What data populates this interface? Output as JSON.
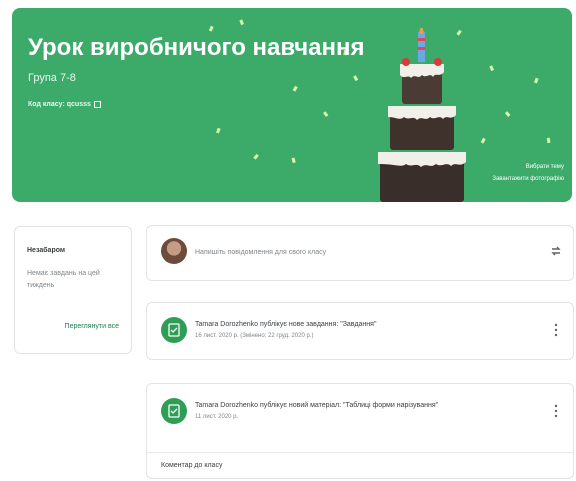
{
  "banner": {
    "title": "Урок виробничого навчання",
    "subtitle": "Група 7-8",
    "class_code": "Код класу: qcusss",
    "link_select": "Вибрати тему",
    "link_upload": "Завантажити фотографію",
    "color": "#3cab6a"
  },
  "sidebar": {
    "title": "Незабаром",
    "text": "Немає завдань на цей тиждень",
    "link": "Переглянути все"
  },
  "announce": {
    "placeholder": "Напишіть повідомлення для свого класу"
  },
  "posts": [
    {
      "title": "Tamara Dorozhenko публікує нове завдання: \"Завдання\"",
      "date": "16 лист. 2020 р. (Змінено: 22 груд. 2020 р.)",
      "icon": "assignment-icon"
    },
    {
      "title": "Tamara Dorozhenko публікує новий матеріал: \"Таблиці форми нарізування\"",
      "date": "11 лист. 2020 р.",
      "icon": "material-icon",
      "comment": "Коментар до класу"
    }
  ],
  "colors": {
    "accent": "#2e9e57",
    "link": "#1e7e4a"
  }
}
